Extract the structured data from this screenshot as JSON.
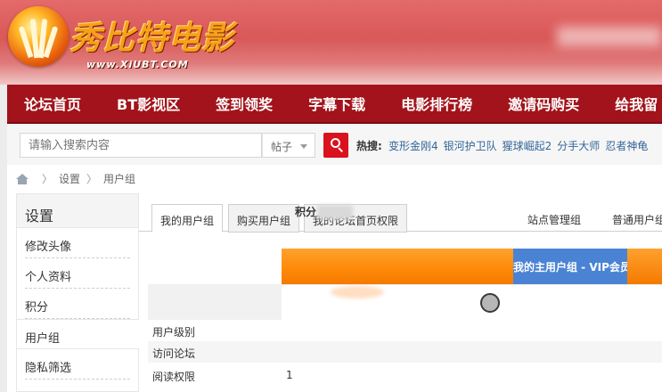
{
  "header": {
    "logo_title": "秀比特电影",
    "logo_url": "www.XiUBT.COM"
  },
  "nav": {
    "items": [
      "论坛首页",
      "BT影视区",
      "签到领奖",
      "字幕下载",
      "电影排行榜",
      "邀请码购买",
      "给我留"
    ]
  },
  "search": {
    "placeholder": "请输入搜索内容",
    "type_value": "帖子",
    "hot_label": "热搜:",
    "hot_links": [
      "变形金刚4",
      "银河护卫队",
      "猩球崛起2",
      "分手大师",
      "忍者神龟"
    ]
  },
  "breadcrumb": {
    "items": [
      "设置",
      "用户组"
    ]
  },
  "sidebar": {
    "title": "设置",
    "items": [
      "修改头像",
      "个人资料",
      "积分",
      "用户组",
      "隐私筛选"
    ]
  },
  "tabs": {
    "items": [
      "我的用户组",
      "购买用户组",
      "我的论坛首页权限"
    ],
    "right": [
      "站点管理组",
      "普通用户组"
    ]
  },
  "group_table": {
    "main_group_label": "我的主用户组 - VIP会员",
    "score_label": "积分",
    "rows": [
      {
        "label": "用户级别",
        "value": ""
      },
      {
        "label": "访问论坛",
        "value": ""
      },
      {
        "label": "阅读权限",
        "value": "1"
      }
    ]
  },
  "colors": {
    "nav_bg": "#a3131b",
    "accent_red": "#d9121d",
    "link_blue": "#336699",
    "banner_orange": "#ff8a0a",
    "banner_blue": "#4b83d4"
  }
}
